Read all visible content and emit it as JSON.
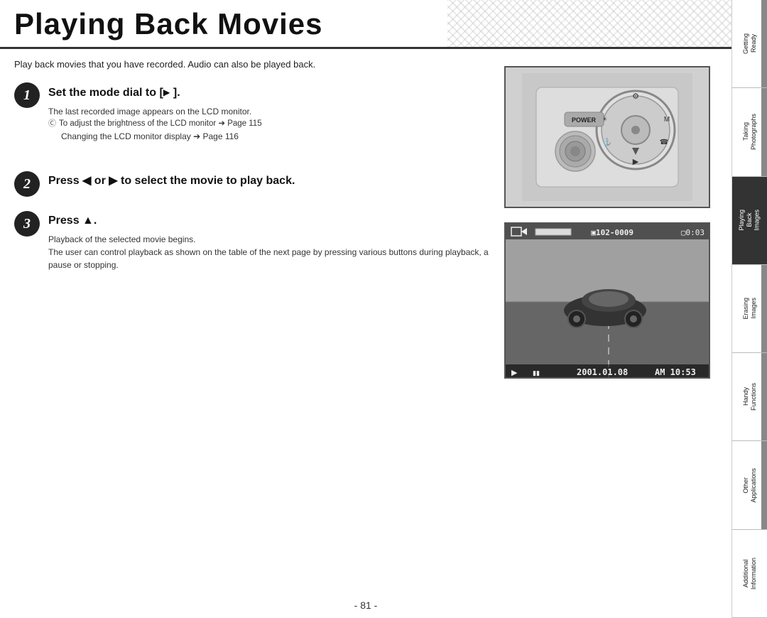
{
  "header": {
    "title": "Playing Back Movies"
  },
  "intro": {
    "text": "Play back movies that you have recorded. Audio can also be played back."
  },
  "steps": [
    {
      "number": "1",
      "title_pre": "Set the mode dial to [",
      "title_symbol": "▶",
      "title_post": " ].",
      "desc_line1": "The last recorded image appears on the LCD monitor.",
      "note1": "To adjust the brightness of the LCD monitor ➔ Page 115",
      "note2": "Changing the LCD monitor display ➔ Page 116"
    },
    {
      "number": "2",
      "title_pre": "Press ",
      "title_symbol1": "◀",
      "title_or": " or ",
      "title_symbol2": "▶",
      "title_post": " to select the movie to play back."
    },
    {
      "number": "3",
      "title_pre": "Press ",
      "title_symbol": "▲",
      "title_post": ".",
      "desc_line1": "Playback of the selected movie begins.",
      "desc_line2": "The user can control playback as shown on the table of the next page by pressing various buttons during playback, a pause or stopping."
    }
  ],
  "screen_info": {
    "file_number": "102-0009",
    "duration": "0:03",
    "date": "2001.01.08",
    "time": "AM 10:53"
  },
  "power_label": "POWER",
  "footer": {
    "page_number": "- 81 -"
  },
  "sidebar": {
    "items": [
      {
        "label": "Getting\nReady"
      },
      {
        "label": "Taking\nPhotographs"
      },
      {
        "label": "Playing\nBack\nImages",
        "active": true
      },
      {
        "label": "Erasing\nImages"
      },
      {
        "label": "Handy\nFunctions"
      },
      {
        "label": "Other\nApplications"
      },
      {
        "label": "Additional\nInformation"
      }
    ]
  }
}
